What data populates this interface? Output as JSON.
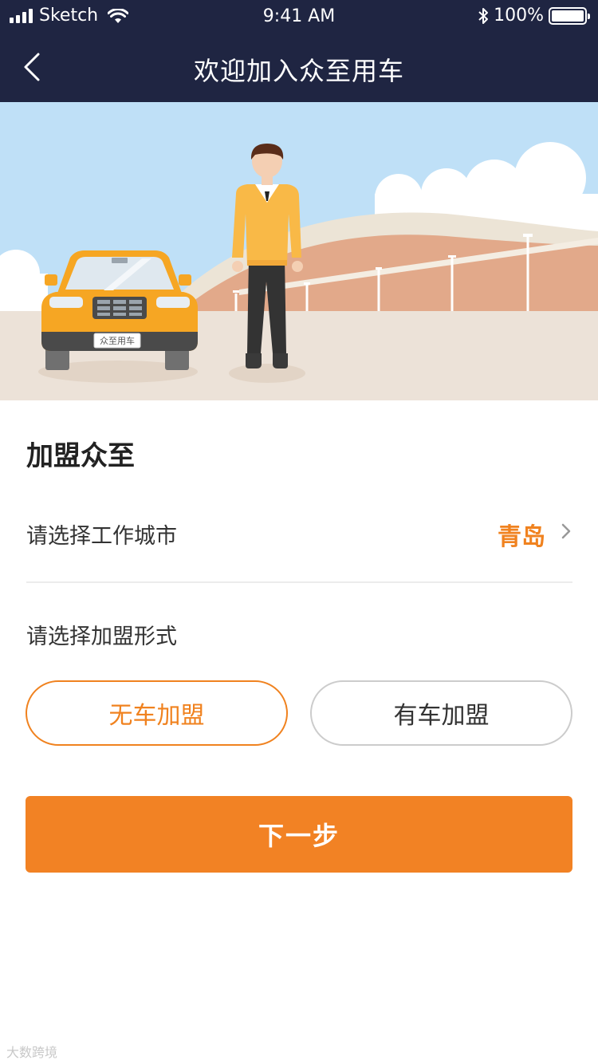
{
  "status_bar": {
    "carrier": "Sketch",
    "time": "9:41 AM",
    "battery_text": "100%",
    "battery_level": 1.0
  },
  "nav": {
    "title": "欢迎加入众至用车",
    "back_icon": "chevron-left-icon"
  },
  "banner": {
    "plate_text": "众至用车"
  },
  "form": {
    "section_title": "加盟众至",
    "city_label": "请选择工作城市",
    "city_value": "青岛",
    "join_label": "请选择加盟形式",
    "options": [
      {
        "label": "无车加盟",
        "selected": true
      },
      {
        "label": "有车加盟",
        "selected": false
      }
    ],
    "next_label": "下一步"
  },
  "watermark": "大数跨境",
  "colors": {
    "nav_bg": "#1f2542",
    "accent": "#f0821f",
    "button": "#f28224"
  }
}
